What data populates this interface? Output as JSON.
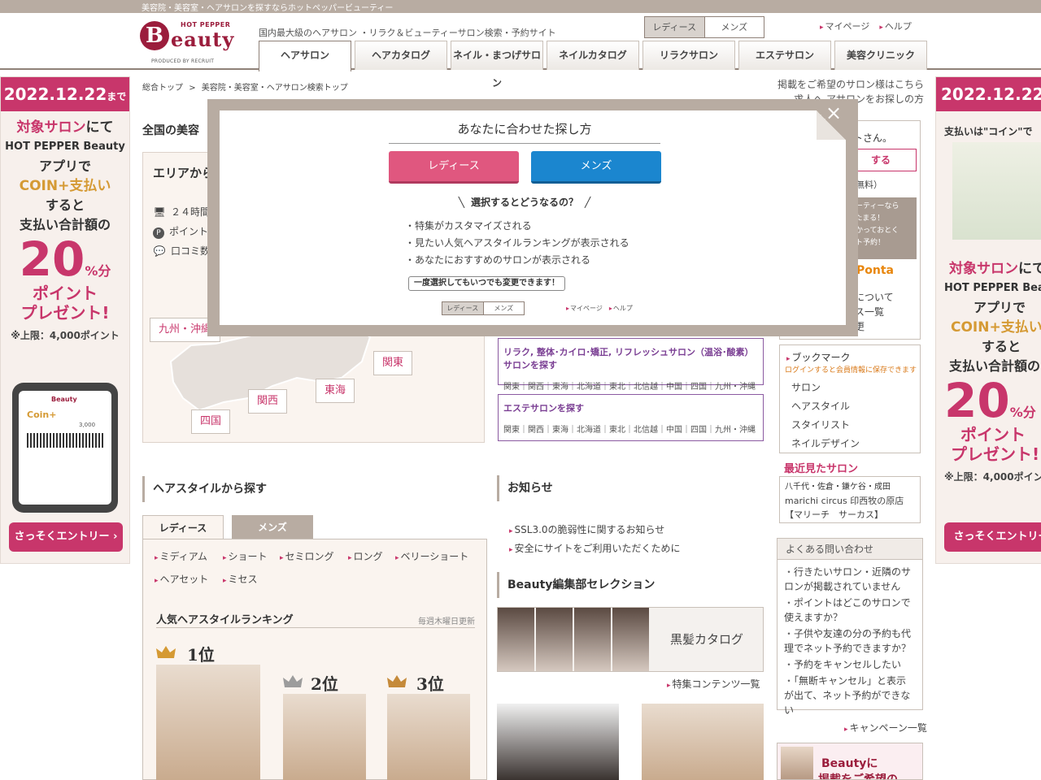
{
  "topbar": {
    "text": "美容院・美容室・ヘアサロンを探すならホットペッパービューティー"
  },
  "header": {
    "logo_hp": "HOT PEPPER",
    "logo_b": "B",
    "logo_word": "eauty",
    "logo_produced": "PRODUCED BY RECRUIT",
    "tagline": "国内最大級のヘアサロン ・リラク＆ビューティーサロン検索・予約サイト",
    "gender": {
      "ladies": "レディース",
      "mens": "メンズ"
    },
    "links": {
      "mypage": "マイページ",
      "help": "ヘルプ"
    },
    "tabs": [
      "ヘアサロン",
      "ヘアカタログ",
      "ネイル・まつげサロン",
      "ネイルカタログ",
      "リラクサロン",
      "エステサロン",
      "美容クリニック"
    ]
  },
  "ad": {
    "date": "2022.12.22",
    "date_suffix": "まで",
    "line1a": "対象サロン",
    "line1b": "にて",
    "line2": "HOT PEPPER Beauty",
    "line3": "アプリで",
    "line4": "COIN+支払い",
    "line5": "すると",
    "line6": "支払い合計額の",
    "pct": "20",
    "pct_suffix": "%分",
    "line7": "ポイント",
    "line8": "プレゼント!",
    "note": "※上限：4,000ポイント",
    "entry": "さっそくエントリー",
    "phone_brand": "Beauty",
    "phone_coin": "Coin+",
    "phone_balance": "3,000",
    "ad2_line1": "支払いは\"コイン\"で"
  },
  "breadcrumb": {
    "top": "総合トップ",
    "sep": ">",
    "current": "美容院・美容室・ヘアサロン検索トップ"
  },
  "right_links": {
    "l1": "掲載をご希望のサロン様はこちら",
    "l2": "求人へ アサロンをお探しの方"
  },
  "main": {
    "title": "全国の美容",
    "area_head": "エリアから",
    "feat1": "２４時間",
    "feat2": "ポイント",
    "feat3": "口コミ数",
    "regions": {
      "kyushu": "九州・沖縄",
      "kanto": "関東",
      "tokai": "東海",
      "kansai": "関西",
      "shikoku": "四国"
    }
  },
  "purple": [
    {
      "title": "リラク, 整体･カイロ･矯正, リフレッシュサロン（温浴･酸素）サロンを探す",
      "links": "関東｜関西｜東海｜北海道｜東北｜北信越｜中国｜四国｜九州・沖縄"
    },
    {
      "title": "エステサロンを探す",
      "links": "関東｜関西｜東海｜北海道｜東北｜北信越｜中国｜四国｜九州・沖縄"
    }
  ],
  "sidebar": {
    "guest": "ストさん。",
    "login": "する",
    "free": "（無料）",
    "promo1": "ューティーなら",
    "promo2": "%たまる！",
    "promo3": "つかっておとく",
    "promo4": "ット予約！",
    "ponta": "Ponta",
    "about": "について",
    "list": "ス一覧",
    "change": "更",
    "bookmark_title": "ブックマーク",
    "bookmark_note": "ログインすると会員情報に保存できます",
    "bookmark_items": [
      "サロン",
      "ヘアスタイル",
      "スタイリスト",
      "ネイルデザイン"
    ],
    "recent_title": "最近見たサロン",
    "recent_area": "八千代・佐倉・鎌ケ谷・成田",
    "recent_salon": "marichi circus 印西牧の原店",
    "recent_salon_kana": "【マリーチ　サーカス】",
    "faq_title": "よくある問い合わせ",
    "faq_items": [
      "行きたいサロン・近隣のサロンが掲載されていません",
      "ポイントはどこのサロンで使えますか？",
      "子供や友達の分の予約も代理でネット予約できますか？",
      "予約をキャンセルしたい",
      "「無断キャンセル」と表示が出て、ネット予約ができない"
    ],
    "campaign": "キャンペーン一覧",
    "banner_text1": "Beautyに",
    "banner_text2": "掲載をご希望の"
  },
  "hairstyle": {
    "title": "ヘアスタイルから探す",
    "tabs": {
      "ladies": "レディース",
      "mens": "メンズ"
    },
    "lengths": [
      "ミディアム",
      "ショート",
      "セミロング",
      "ロング",
      "ベリーショート",
      "ヘアセット",
      "ミセス"
    ],
    "rank_title": "人気ヘアスタイルランキング",
    "rank_date": "毎週木曜日更新",
    "ranks": [
      "1位",
      "2位",
      "3位"
    ]
  },
  "news": {
    "title": "お知らせ",
    "items": [
      "SSL3.0の脆弱性に関するお知らせ",
      "安全にサイトをご利用いただくために"
    ]
  },
  "selection": {
    "title": "Beauty編集部セレクション",
    "catalog": "黒髪カタログ",
    "feature_link": "特集コンテンツ一覧"
  },
  "modal": {
    "title": "あなたに合わせた探し方",
    "ladies": "レディース",
    "mens": "メンズ",
    "question": "選択するとどうなるの？",
    "items": [
      "・特集がカスタマイズされる",
      "・見たい人気ヘアスタイルランキングが表示される",
      "・あなたにおすすめのサロンが表示される"
    ],
    "bubble": "一度選択してもいつでも変更できます！",
    "mini_ladies": "レディース",
    "mini_mens": "メンズ",
    "mini_mypage": "マイページ",
    "mini_help": "ヘルプ",
    "close": "×"
  }
}
